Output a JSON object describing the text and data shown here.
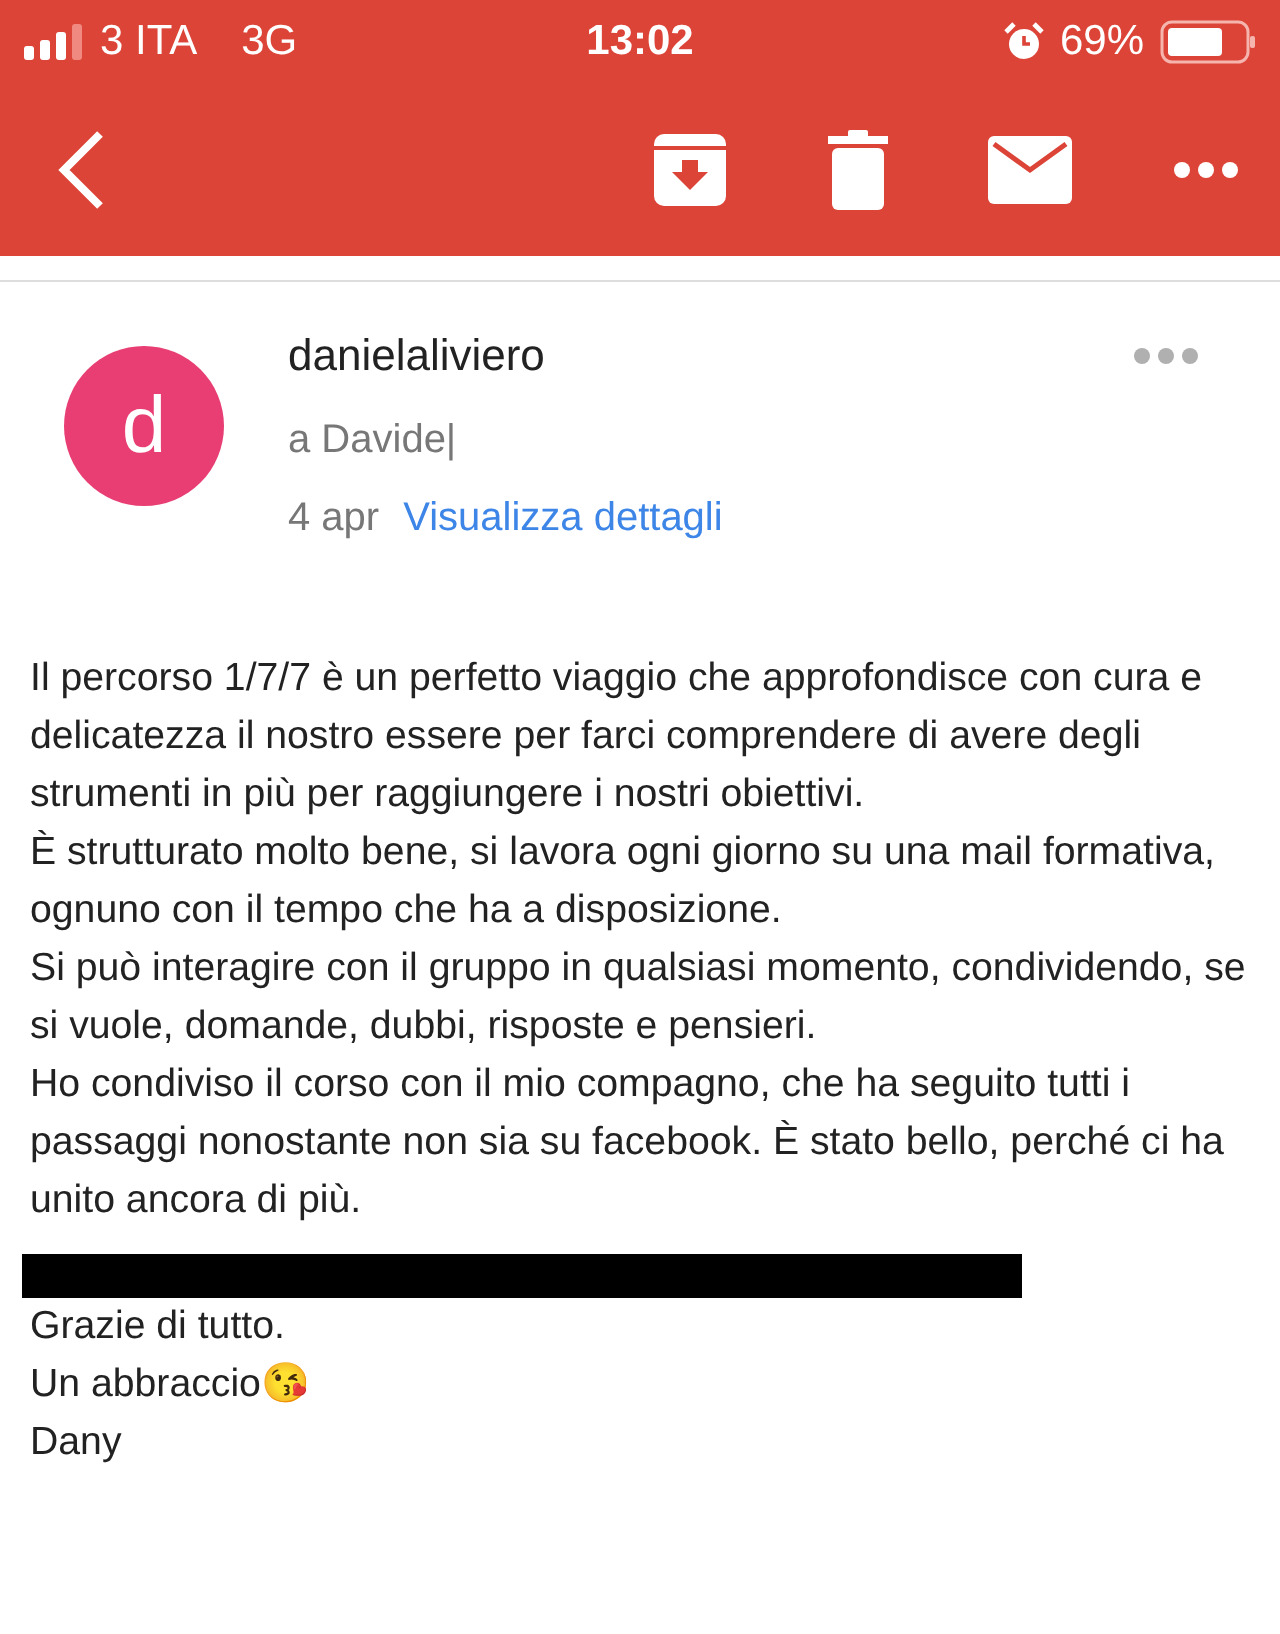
{
  "status_bar": {
    "carrier": "3 ITA",
    "network": "3G",
    "time": "13:02",
    "battery": "69%"
  },
  "sender": {
    "avatar_letter": "d",
    "name": "danielaliviero",
    "recipient": "a Davide|",
    "date": "4 apr",
    "details_link": "Visualizza dettagli"
  },
  "body": [
    "Il percorso 1/7/7 è un perfetto viaggio che approfondisce con cura e delicatezza il nostro essere  per farci comprendere di avere degli strumenti in più per raggiungere i nostri obiettivi.",
    "È strutturato molto bene, si lavora ogni giorno su una mail formativa, ognuno con il tempo che ha a disposizione.",
    "Si può interagire con il gruppo in qualsiasi momento, condividendo, se si vuole, domande, dubbi, risposte e pensieri.",
    "Ho condiviso il corso con il mio compagno, che ha seguito tutti i passaggi nonostante non sia su facebook. È stato bello, perché ci ha unito ancora di più."
  ],
  "closing": [
    {
      "kind": "redacted"
    },
    {
      "kind": "text",
      "text": "Grazie di tutto."
    },
    {
      "kind": "text",
      "text": "Un abbraccio😘"
    },
    {
      "kind": "text",
      "text": "Dany"
    }
  ]
}
